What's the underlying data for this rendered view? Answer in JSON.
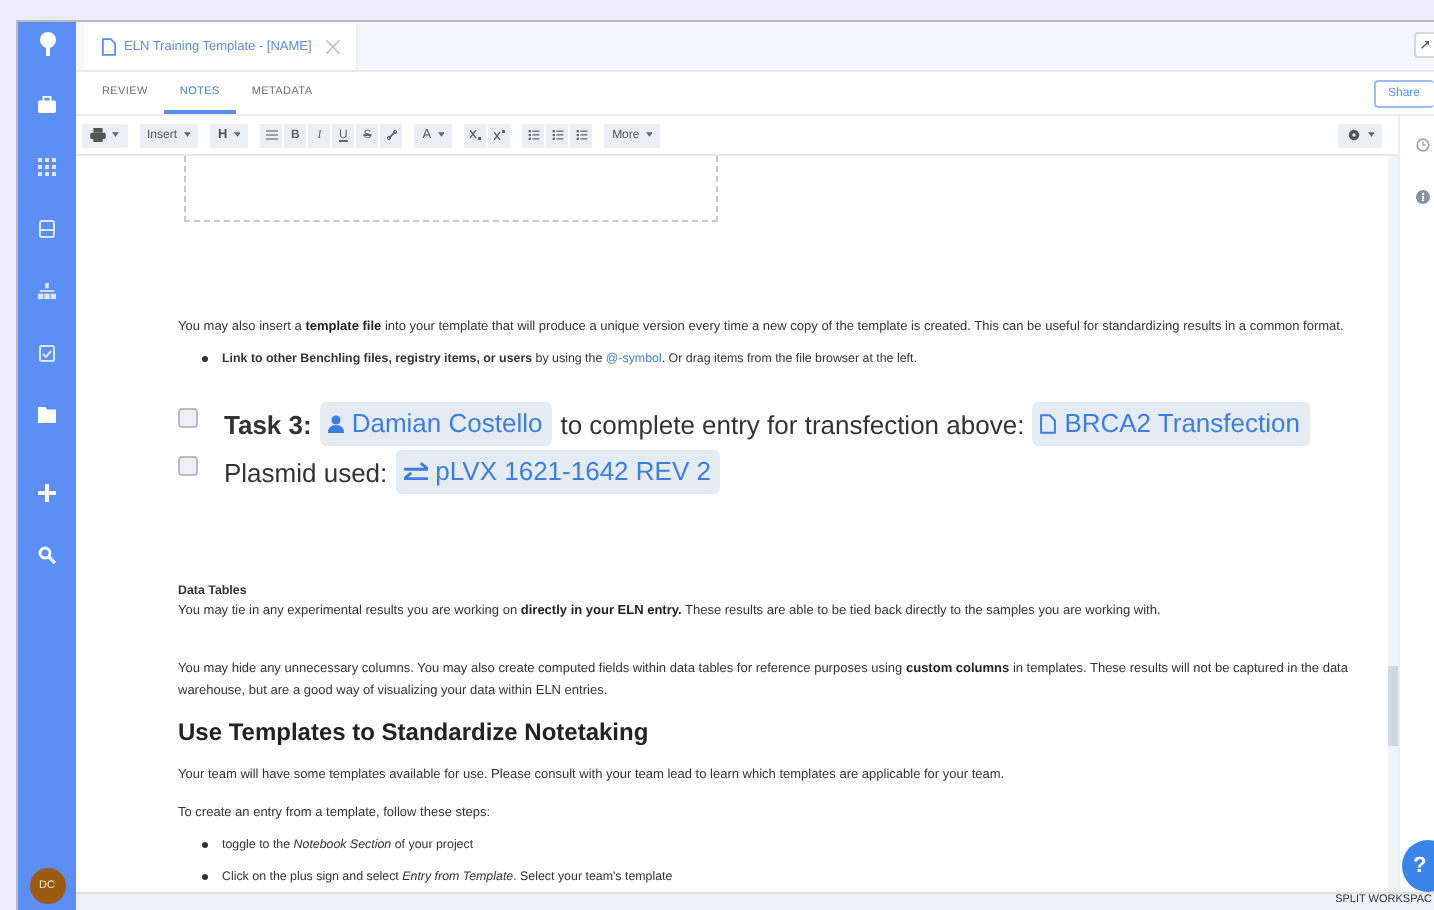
{
  "avatar": {
    "initials": "DC"
  },
  "tab": {
    "title": "ELN Training Template - [NAME]"
  },
  "subtabs": [
    {
      "label": "REVIEW",
      "selected": false
    },
    {
      "label": "NOTES",
      "selected": true
    },
    {
      "label": "METADATA",
      "selected": false
    }
  ],
  "share_button": "Share",
  "toolbar": {
    "insert": "Insert",
    "heading": "H",
    "format": [
      "B",
      "I",
      "U",
      "S"
    ],
    "font_label": "A",
    "more": "More"
  },
  "document": [
    {
      "kind": "paragraph",
      "text": "You may also insert a **template file** into your template that will produce a unique version every time a new copy of the template is created.  This can be useful for standardizing results in a common format."
    },
    {
      "kind": "bullet",
      "text": "**Link to other Benchling files, registry items, or users** by using the ",
      "link": "@-symbol",
      "after": ". Or drag items from the file browser at the left."
    },
    {
      "kind": "task",
      "checked": false,
      "parts": [
        {
          "kind": "bold",
          "text": "Task 3:"
        },
        {
          "kind": "user",
          "text": "Damian Costello"
        },
        {
          "kind": "text",
          "text": "to complete entry for transfection above:"
        },
        {
          "kind": "entry",
          "text": "BRCA2 Transfection"
        }
      ]
    },
    {
      "kind": "task",
      "checked": false,
      "parts": [
        {
          "kind": "text",
          "text": "Plasmid used:"
        },
        {
          "kind": "sequence",
          "text": "pLVX 1621-1642 REV 2"
        }
      ]
    },
    {
      "kind": "subheading",
      "text": "Data Tables"
    },
    {
      "kind": "paragraph",
      "text": "You may tie in any experimental results you are working on **directly in your ELN entry.**  These results are able to be tied back directly to the samples you are working with."
    },
    {
      "kind": "paragraph",
      "text": "You may hide any unnecessary columns.  You may also create computed fields within data tables for reference purposes using **custom columns** in templates.  These results will not be captured in the data warehouse, but are a good way of visualizing your data within ELN entries."
    },
    {
      "kind": "heading",
      "text": "Use Templates to Standardize Notetaking"
    },
    {
      "kind": "paragraph",
      "text": "Your team will have some templates available for use. Please consult with your team lead to learn which templates are applicable for your team."
    },
    {
      "kind": "paragraph",
      "text": "To create an entry from a template, follow these steps:"
    },
    {
      "kind": "bullet",
      "text": "toggle to the *Notebook Section* of your project"
    },
    {
      "kind": "bullet",
      "text": "Click on the plus sign and select *Entry from Template*. Select your team's template"
    }
  ],
  "help_button": "?",
  "status_bar": {
    "split_button": "SPLIT WORKSPAC"
  }
}
